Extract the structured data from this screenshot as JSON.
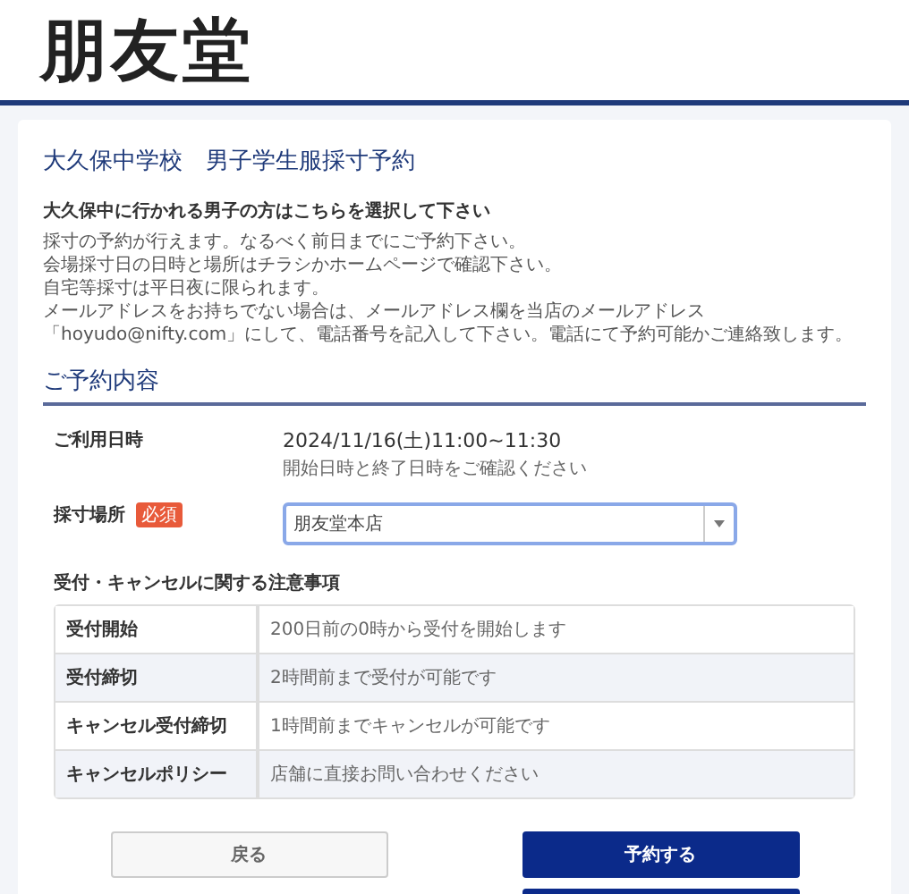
{
  "logo": "朋友堂",
  "page_title": "大久保中学校　男子学生服採寸予約",
  "intro": {
    "heading": "大久保中に行かれる男子の方はこちらを選択して下さい",
    "lines": [
      "採寸の予約が行えます。なるべく前日までにご予約下さい。",
      "会場採寸日の日時と場所はチラシかホームページで確認下さい。",
      "自宅等採寸は平日夜に限られます。",
      "メールアドレスをお持ちでない場合は、メールアドレス欄を当店のメールアドレス「hoyudo@nifty.com」にして、電話番号を記入して下さい。電話にて予約可能かご連絡致します。"
    ]
  },
  "section_title": "ご予約内容",
  "fields": [
    {
      "kind": "text",
      "label": "ご利用日時",
      "value": "2024/11/16(土)11:00~11:30",
      "note": "開始日時と終了日時をご確認ください"
    },
    {
      "kind": "select",
      "label": "採寸場所",
      "badge": "必須",
      "value": "朋友堂本店"
    }
  ],
  "notice": {
    "title": "受付・キャンセルに関する注意事項",
    "rows": [
      {
        "label": "受付開始",
        "value": "200日前の0時から受付を開始します"
      },
      {
        "label": "受付締切",
        "value": "2時間前まで受付が可能です"
      },
      {
        "label": "キャンセル受付締切",
        "value": "1時間前までキャンセルが可能です"
      },
      {
        "label": "キャンセルポリシー",
        "value": "店舗に直接お問い合わせください"
      }
    ]
  },
  "buttons": [
    {
      "kind": "secondary",
      "label": "戻る"
    },
    {
      "kind": "primary",
      "label": "予約する"
    }
  ]
}
